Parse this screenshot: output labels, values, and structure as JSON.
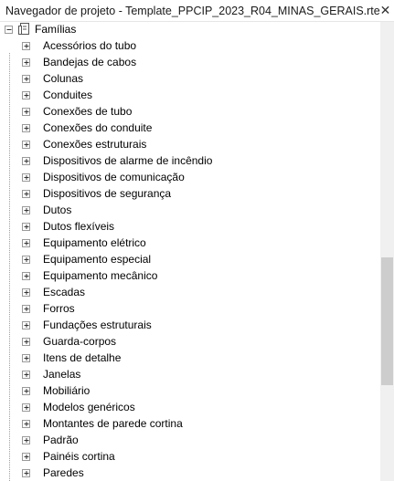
{
  "window": {
    "title": "Navegador de projeto - Template_PPCIP_2023_R04_MINAS_GERAIS.rte",
    "close_icon": "close-icon"
  },
  "tree": {
    "root": {
      "label": "Famílias",
      "expanded": true,
      "icon": "families-folder-icon"
    },
    "children": [
      "Acessórios do tubo",
      "Bandejas de cabos",
      "Colunas",
      "Conduites",
      "Conexões de tubo",
      "Conexões do conduite",
      "Conexões estruturais",
      "Dispositivos de alarme de incêndio",
      "Dispositivos de comunicação",
      "Dispositivos de segurança",
      "Dutos",
      "Dutos flexíveis",
      "Equipamento elétrico",
      "Equipamento especial",
      "Equipamento mecânico",
      "Escadas",
      "Forros",
      "Fundações estruturais",
      "Guarda-corpos",
      "Itens de detalhe",
      "Janelas",
      "Mobiliário",
      "Modelos genéricos",
      "Montantes de parede cortina",
      "Padrão",
      "Painéis cortina",
      "Paredes"
    ]
  },
  "scrollbar": {
    "position_fraction": 0.55
  }
}
